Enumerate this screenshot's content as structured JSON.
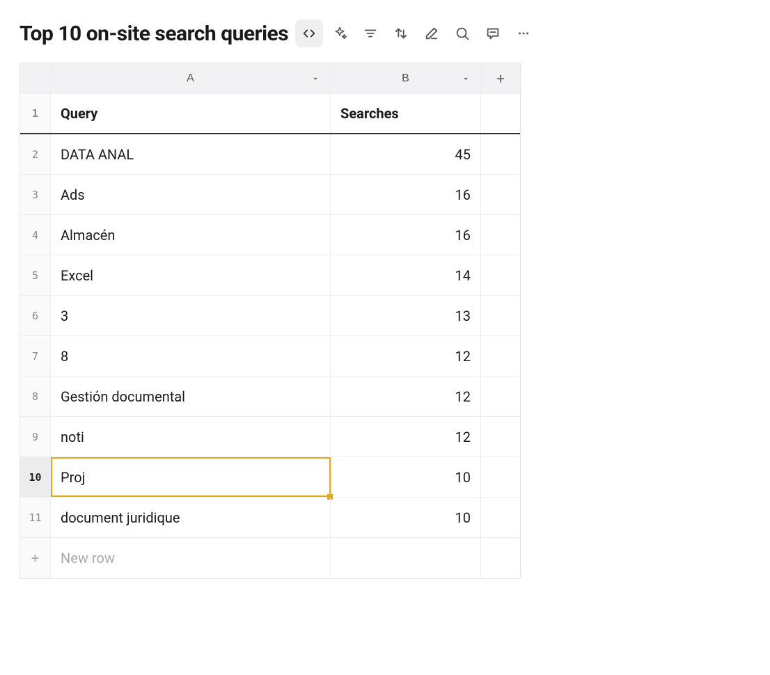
{
  "title": "Top 10 on-site search queries",
  "columns": {
    "A": "A",
    "B": "B"
  },
  "headers": {
    "query": "Query",
    "searches": "Searches"
  },
  "rows": [
    {
      "n": "1",
      "query": "Query",
      "searches": "Searches",
      "isHeader": true
    },
    {
      "n": "2",
      "query": "DATA ANAL",
      "searches": "45"
    },
    {
      "n": "3",
      "query": "Ads",
      "searches": "16"
    },
    {
      "n": "4",
      "query": "Almacén",
      "searches": "16"
    },
    {
      "n": "5",
      "query": "Excel",
      "searches": "14"
    },
    {
      "n": "6",
      "query": "3",
      "searches": "13"
    },
    {
      "n": "7",
      "query": "8",
      "searches": "12"
    },
    {
      "n": "8",
      "query": "Gestión documental",
      "searches": "12"
    },
    {
      "n": "9",
      "query": "noti",
      "searches": "12"
    },
    {
      "n": "10",
      "query": "Proj",
      "searches": "10",
      "selected": true
    },
    {
      "n": "11",
      "query": "document juridique",
      "searches": "10"
    }
  ],
  "newRow": {
    "label": "New row",
    "plus": "+"
  },
  "addColumn": "+",
  "chart_data": {
    "type": "table",
    "title": "Top 10 on-site search queries",
    "columns": [
      "Query",
      "Searches"
    ],
    "rows": [
      [
        "DATA ANAL",
        45
      ],
      [
        "Ads",
        16
      ],
      [
        "Almacén",
        16
      ],
      [
        "Excel",
        14
      ],
      [
        "3",
        13
      ],
      [
        "8",
        12
      ],
      [
        "Gestión documental",
        12
      ],
      [
        "noti",
        12
      ],
      [
        "Proj",
        10
      ],
      [
        "document juridique",
        10
      ]
    ]
  }
}
